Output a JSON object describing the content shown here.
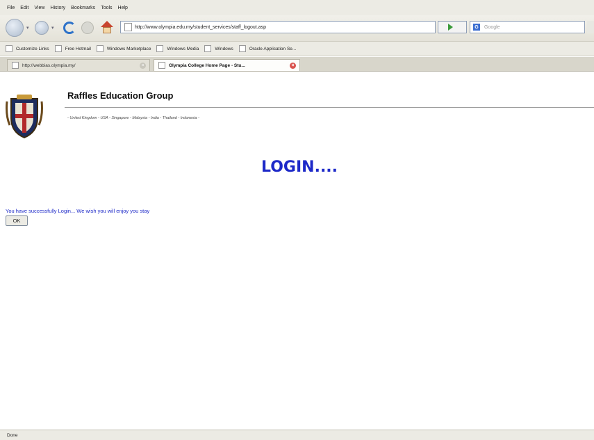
{
  "menu": [
    "File",
    "Edit",
    "View",
    "History",
    "Bookmarks",
    "Tools",
    "Help"
  ],
  "toolbar": {
    "url": "http://www.olympia.edu.my/student_services/staff_logout.asp",
    "search_placeholder": "Google"
  },
  "bookmarks": [
    "Customize Links",
    "Free Hotmail",
    "Windows Marketplace",
    "Windows Media",
    "Windows",
    "Oracle Application Se..."
  ],
  "tabs": [
    {
      "label": "http://webbias.olympia.my/"
    },
    {
      "label": "Olympia College Home Page - Stu..."
    }
  ],
  "page": {
    "org_name": "Raffles Education Group",
    "countries": "- United Kingdom - USA - Singapore - Malaysia - India - Thailand - Indonesia -",
    "heading": "LOGIN....",
    "message": "You have successfully Login... We wish you will enjoy you stay",
    "ok_label": "OK"
  },
  "status": "Done",
  "colors": {
    "heading": "#1d29c8",
    "message": "#1d29c8"
  }
}
